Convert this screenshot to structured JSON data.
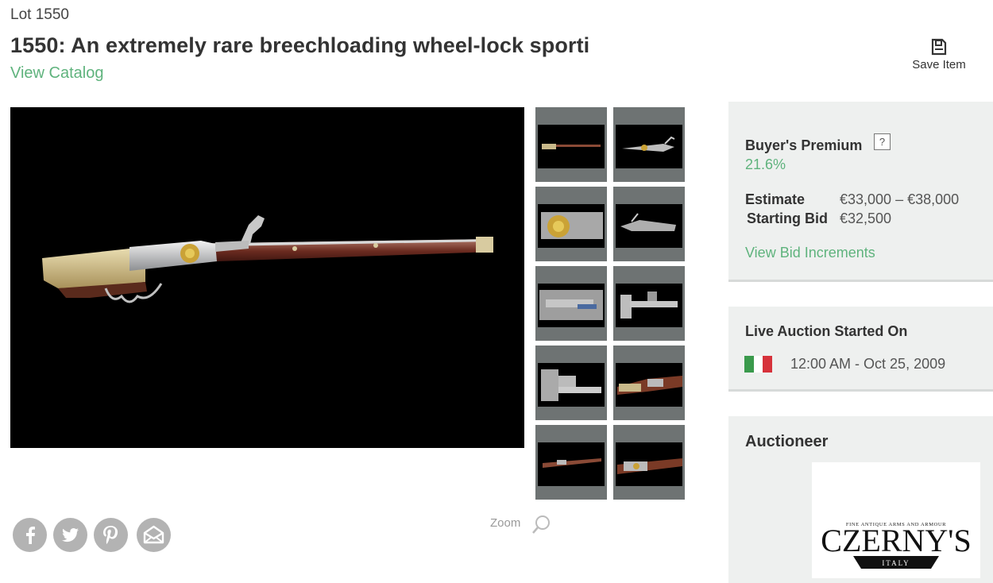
{
  "lot": {
    "label": "Lot 1550",
    "title": "1550: An extremely rare breechloading wheel-lock sporti",
    "catalog_link": "View Catalog"
  },
  "save": {
    "label": "Save Item",
    "icon": "floppy-disk-icon"
  },
  "gallery": {
    "zoom_label": "Zoom",
    "thumbnail_count": 10
  },
  "social": {
    "icons": [
      "facebook-icon",
      "twitter-icon",
      "pinterest-icon",
      "email-icon"
    ]
  },
  "sidebar": {
    "premium": {
      "label": "Buyer's Premium",
      "help": "?",
      "value": "21.6%"
    },
    "estimate": {
      "label": "Estimate",
      "value": "€33,000 – €38,000"
    },
    "starting_bid": {
      "label": "Starting Bid",
      "value": "€32,500"
    },
    "increments_link": "View Bid Increments",
    "live_auction": {
      "label": "Live Auction Started On",
      "datetime": "12:00 AM - Oct 25, 2009"
    },
    "auctioneer": {
      "label": "Auctioneer",
      "logo_top_text": "FINE ANTIQUE ARMS AND ARMOUR",
      "logo_name": "CZERNY'S",
      "logo_ribbon": "ITALY"
    }
  },
  "colors": {
    "accent_green": "#5fb37d",
    "panel_bg": "#eef0ef",
    "thumb_frame": "#6e7373",
    "flag": [
      "#3a9a4c",
      "#ffffff",
      "#d6323b"
    ]
  }
}
